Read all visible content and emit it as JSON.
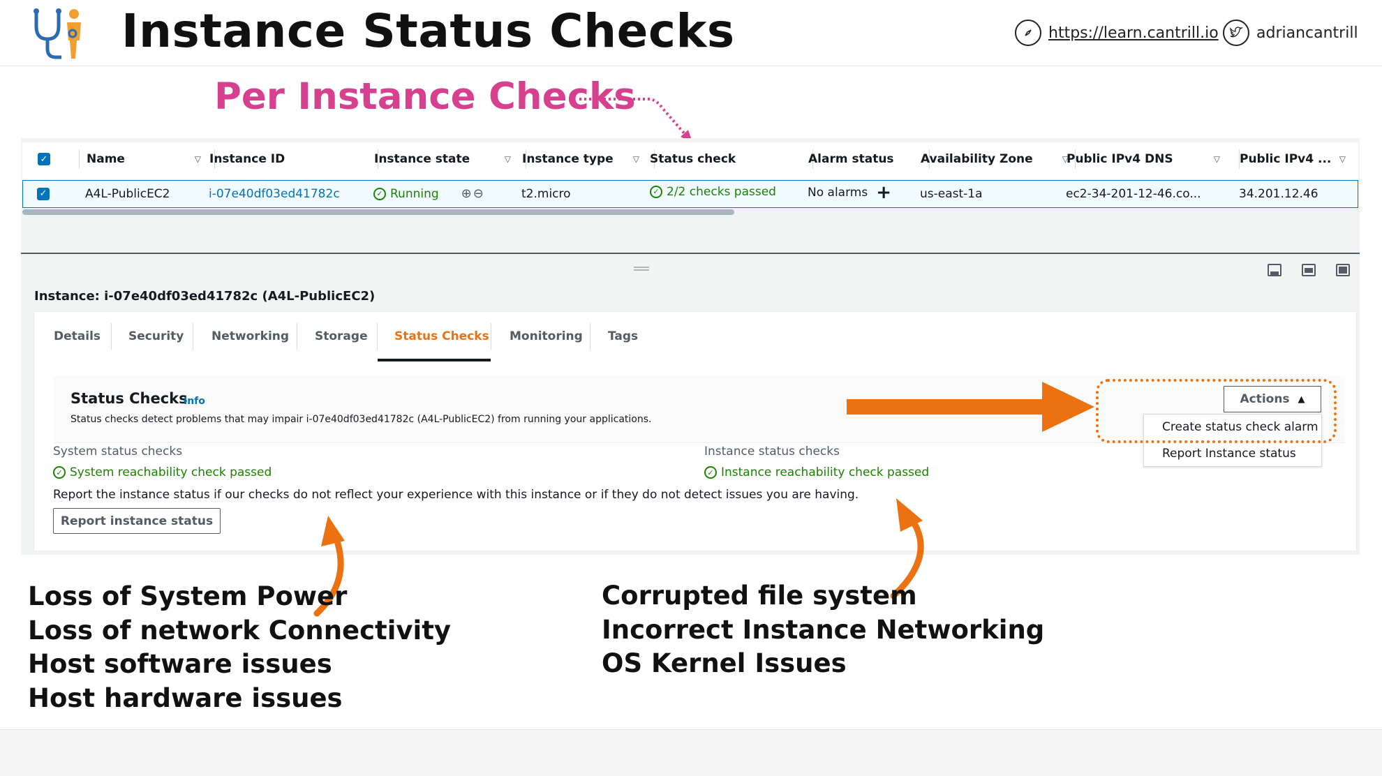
{
  "header": {
    "title": "Instance Status Checks",
    "logo_icon": "stethoscope-person-icon",
    "site_link": "https://learn.cantrill.io",
    "twitter_handle": "adriancantrill"
  },
  "annotations": {
    "per_instance": "Per Instance Checks",
    "pink_color": "#d6408f",
    "orange_color": "#ec7211"
  },
  "table": {
    "columns": [
      "Name",
      "Instance ID",
      "Instance state",
      "Instance type",
      "Status check",
      "Alarm status",
      "Availability Zone",
      "Public IPv4 DNS",
      "Public IPv4 ..."
    ],
    "row": {
      "name": "A4L-PublicEC2",
      "instance_id": "i-07e40df03ed41782c",
      "state": "Running",
      "type": "t2.micro",
      "status_check": "2/2 checks passed",
      "alarm_status": "No alarms",
      "az": "us-east-1a",
      "dns": "ec2-34-201-12-46.co...",
      "ipv4": "34.201.12.46"
    }
  },
  "details": {
    "instance_title": "Instance: i-07e40df03ed41782c (A4L-PublicEC2)",
    "tabs": [
      "Details",
      "Security",
      "Networking",
      "Storage",
      "Status Checks",
      "Monitoring",
      "Tags"
    ],
    "active_tab": "Status Checks",
    "section_title": "Status Checks",
    "info_link": "Info",
    "description": "Status checks detect problems that may impair i-07e40df03ed41782c (A4L-PublicEC2) from running your applications.",
    "system_label": "System status checks",
    "system_result": "System reachability check passed",
    "instance_label": "Instance status checks",
    "instance_result": "Instance reachability check passed",
    "report_text": "Report the instance status if our checks do not reflect your experience with this instance or if they do not detect issues you are having.",
    "report_button": "Report instance status",
    "actions_button": "Actions",
    "actions_menu": [
      "Create status check alarm",
      "Report Instance status"
    ]
  },
  "system_issues": [
    "Loss of System Power",
    "Loss of network Connectivity",
    "Host software issues",
    "Host hardware issues"
  ],
  "instance_issues": [
    "Corrupted file system",
    "Incorrect Instance Networking",
    "OS Kernel Issues"
  ]
}
